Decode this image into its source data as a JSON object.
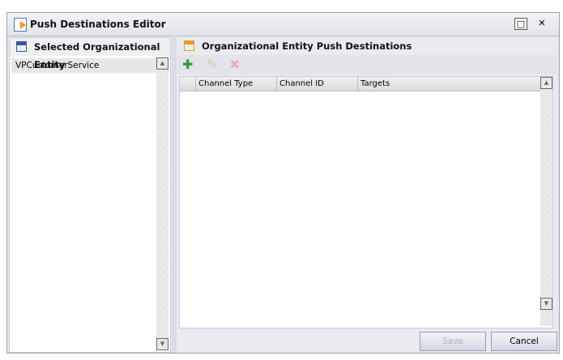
{
  "window": {
    "title": "Push Destinations Editor"
  },
  "left": {
    "title": "Selected Organizational Entity",
    "items": [
      "VPCustomerService"
    ]
  },
  "right": {
    "title": "Organizational Entity Push Destinations",
    "columns": [
      "Channel Type",
      "Channel ID",
      "Targets"
    ],
    "rows": []
  },
  "buttons": {
    "save": "Save",
    "cancel": "Cancel"
  }
}
